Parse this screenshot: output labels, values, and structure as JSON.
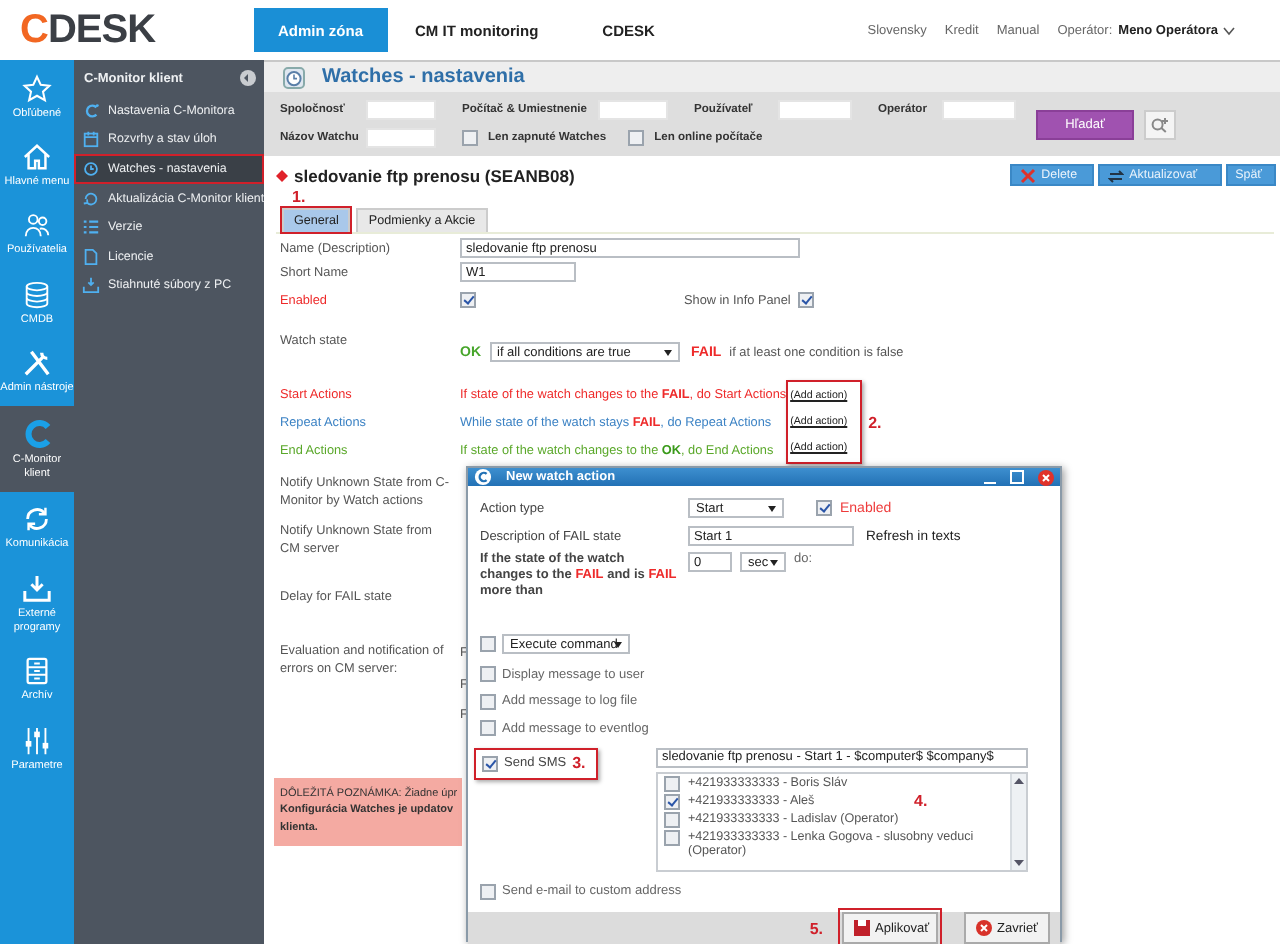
{
  "header": {
    "logo": "CDESK",
    "nav": [
      {
        "label": "Admin zóna",
        "selected": true
      },
      {
        "label": "CM IT monitoring",
        "selected": false
      },
      {
        "label": "CDESK",
        "selected": false
      }
    ],
    "links": [
      "Slovensky",
      "Kredit",
      "Manual"
    ],
    "operator_label": "Operátor:",
    "operator_name": "Meno Operátora"
  },
  "icon_rail": [
    {
      "label": "Obľúbené",
      "selected": false
    },
    {
      "label": "Hlavné menu",
      "selected": false
    },
    {
      "label": "Používatelia",
      "selected": false
    },
    {
      "label": "CMDB",
      "selected": false
    },
    {
      "label": "Admin nástroje",
      "selected": false
    },
    {
      "label": "C-Monitor klient",
      "selected": true
    },
    {
      "label": "Komunikácia",
      "selected": false
    },
    {
      "label": "Externé programy",
      "selected": false
    },
    {
      "label": "Archív",
      "selected": false
    },
    {
      "label": "Parametre",
      "selected": false
    }
  ],
  "sidebar": {
    "title": "C-Monitor klient",
    "items": [
      {
        "label": "Nastavenia C-Monitora",
        "selected": false
      },
      {
        "label": "Rozvrhy a stav úloh",
        "selected": false
      },
      {
        "label": "Watches - nastavenia",
        "selected": true
      },
      {
        "label": "Aktualizácia C-Monitor klient",
        "selected": false
      },
      {
        "label": "Verzie",
        "selected": false
      },
      {
        "label": "Licencie",
        "selected": false
      },
      {
        "label": "Stiahnuté súbory z PC",
        "selected": false
      }
    ]
  },
  "page": {
    "title": "Watches - nastavenia",
    "filters": [
      {
        "label": "Spoločnosť"
      },
      {
        "label": "Počítač & Umiestnenie"
      },
      {
        "label": "Používateľ"
      },
      {
        "label": "Operátor"
      },
      {
        "label": "Názov Watchu"
      }
    ],
    "filter_checks": [
      {
        "label": "Len zapnuté Watches",
        "checked": false
      },
      {
        "label": "Len online počítače",
        "checked": false
      }
    ],
    "search_button": "Hľadať"
  },
  "watch": {
    "name": "sledovanie ftp prenosu (SEANB08)",
    "buttons": [
      "Delete",
      "Aktualizovať",
      "Späť"
    ],
    "tab_annotation": "1.",
    "tabs": [
      {
        "label": "General",
        "selected": true
      },
      {
        "label": "Podmienky a Akcie",
        "selected": false
      }
    ]
  },
  "form": {
    "name_label": "Name (Description)",
    "name_value": "sledovanie ftp prenosu",
    "short_label": "Short Name",
    "short_value": "W1",
    "enabled_label": "Enabled",
    "enabled": true,
    "info_label": "Show in Info Panel",
    "info_panel": true,
    "state_label": "Watch state",
    "ok": "OK",
    "ok_condition": "if all conditions are true",
    "fail": "FAIL",
    "fail_condition": "if at least one condition is false",
    "actions": [
      {
        "kind": "start",
        "label": "Start Actions",
        "text": "If state of the watch changes to the **FAIL**, do Start Actions",
        "link": "(Add action)"
      },
      {
        "kind": "repeat",
        "label": "Repeat Actions",
        "text": "While state of the watch stays **FAIL**, do Repeat Actions",
        "link": "(Add action)"
      },
      {
        "kind": "end",
        "label": "End Actions",
        "text": "If state of the watch changes to the **OK**, do End Actions",
        "link": "(Add action)"
      }
    ],
    "actions_annotation": "2.",
    "other_rows": [
      {
        "label": "Notify Unknown State from C-Monitor by Watch actions"
      },
      {
        "label": "Notify Unknown State from CM server"
      },
      {
        "label": "Delay for FAIL state"
      },
      {
        "label": "Evaluation and notification of errors on CM server:",
        "covered": [
          "F",
          "F",
          "F"
        ]
      }
    ],
    "note": [
      "DÔLEŽITÁ POZNÁMKA: Žiadne úpr",
      "**Konfigurácia Watches je updatov**",
      "**klienta.**"
    ]
  },
  "dialog": {
    "title": "New watch action",
    "action_type_label": "Action type",
    "action_type": "Start",
    "enabled_label": "Enabled",
    "enabled": true,
    "desc_label": "Description of FAIL state",
    "desc_value": "Start 1",
    "refresh": "Refresh in texts",
    "delay_label": "If the state of the watch changes to the **FAIL** and is **FAIL** more than",
    "delay_value": "0",
    "delay_unit": "sec",
    "do": "do:",
    "actions": [
      {
        "kind": "select",
        "label": "Execute command",
        "checked": false
      },
      {
        "kind": "check",
        "label": "Display message to user",
        "checked": false
      },
      {
        "kind": "check",
        "label": "Add message to log file",
        "checked": false
      },
      {
        "kind": "check",
        "label": "Add message to eventlog",
        "checked": false
      },
      {
        "kind": "sms",
        "label": "Send SMS",
        "checked": true,
        "annotation": "3.",
        "message": "sledovanie ftp prenosu - Start 1 - $computer$ $company$",
        "recipients_annotation": "4.",
        "recipients": [
          {
            "label": "+421933333333 - Boris Sláv",
            "checked": false
          },
          {
            "label": "+421933333333 - Aleš",
            "checked": true
          },
          {
            "label": "+421933333333 - Ladislav (Operator)",
            "checked": false
          },
          {
            "label": "+421933333333 - Lenka Gogova - slusobny veduci (Operator)",
            "checked": false
          }
        ]
      },
      {
        "kind": "check",
        "label": "Send e-mail to custom address",
        "checked": false
      }
    ],
    "footer_annotation": "5.",
    "buttons": [
      {
        "kind": "apply",
        "label": "Aplikovať"
      },
      {
        "kind": "close",
        "label": "Zavrieť"
      }
    ]
  }
}
